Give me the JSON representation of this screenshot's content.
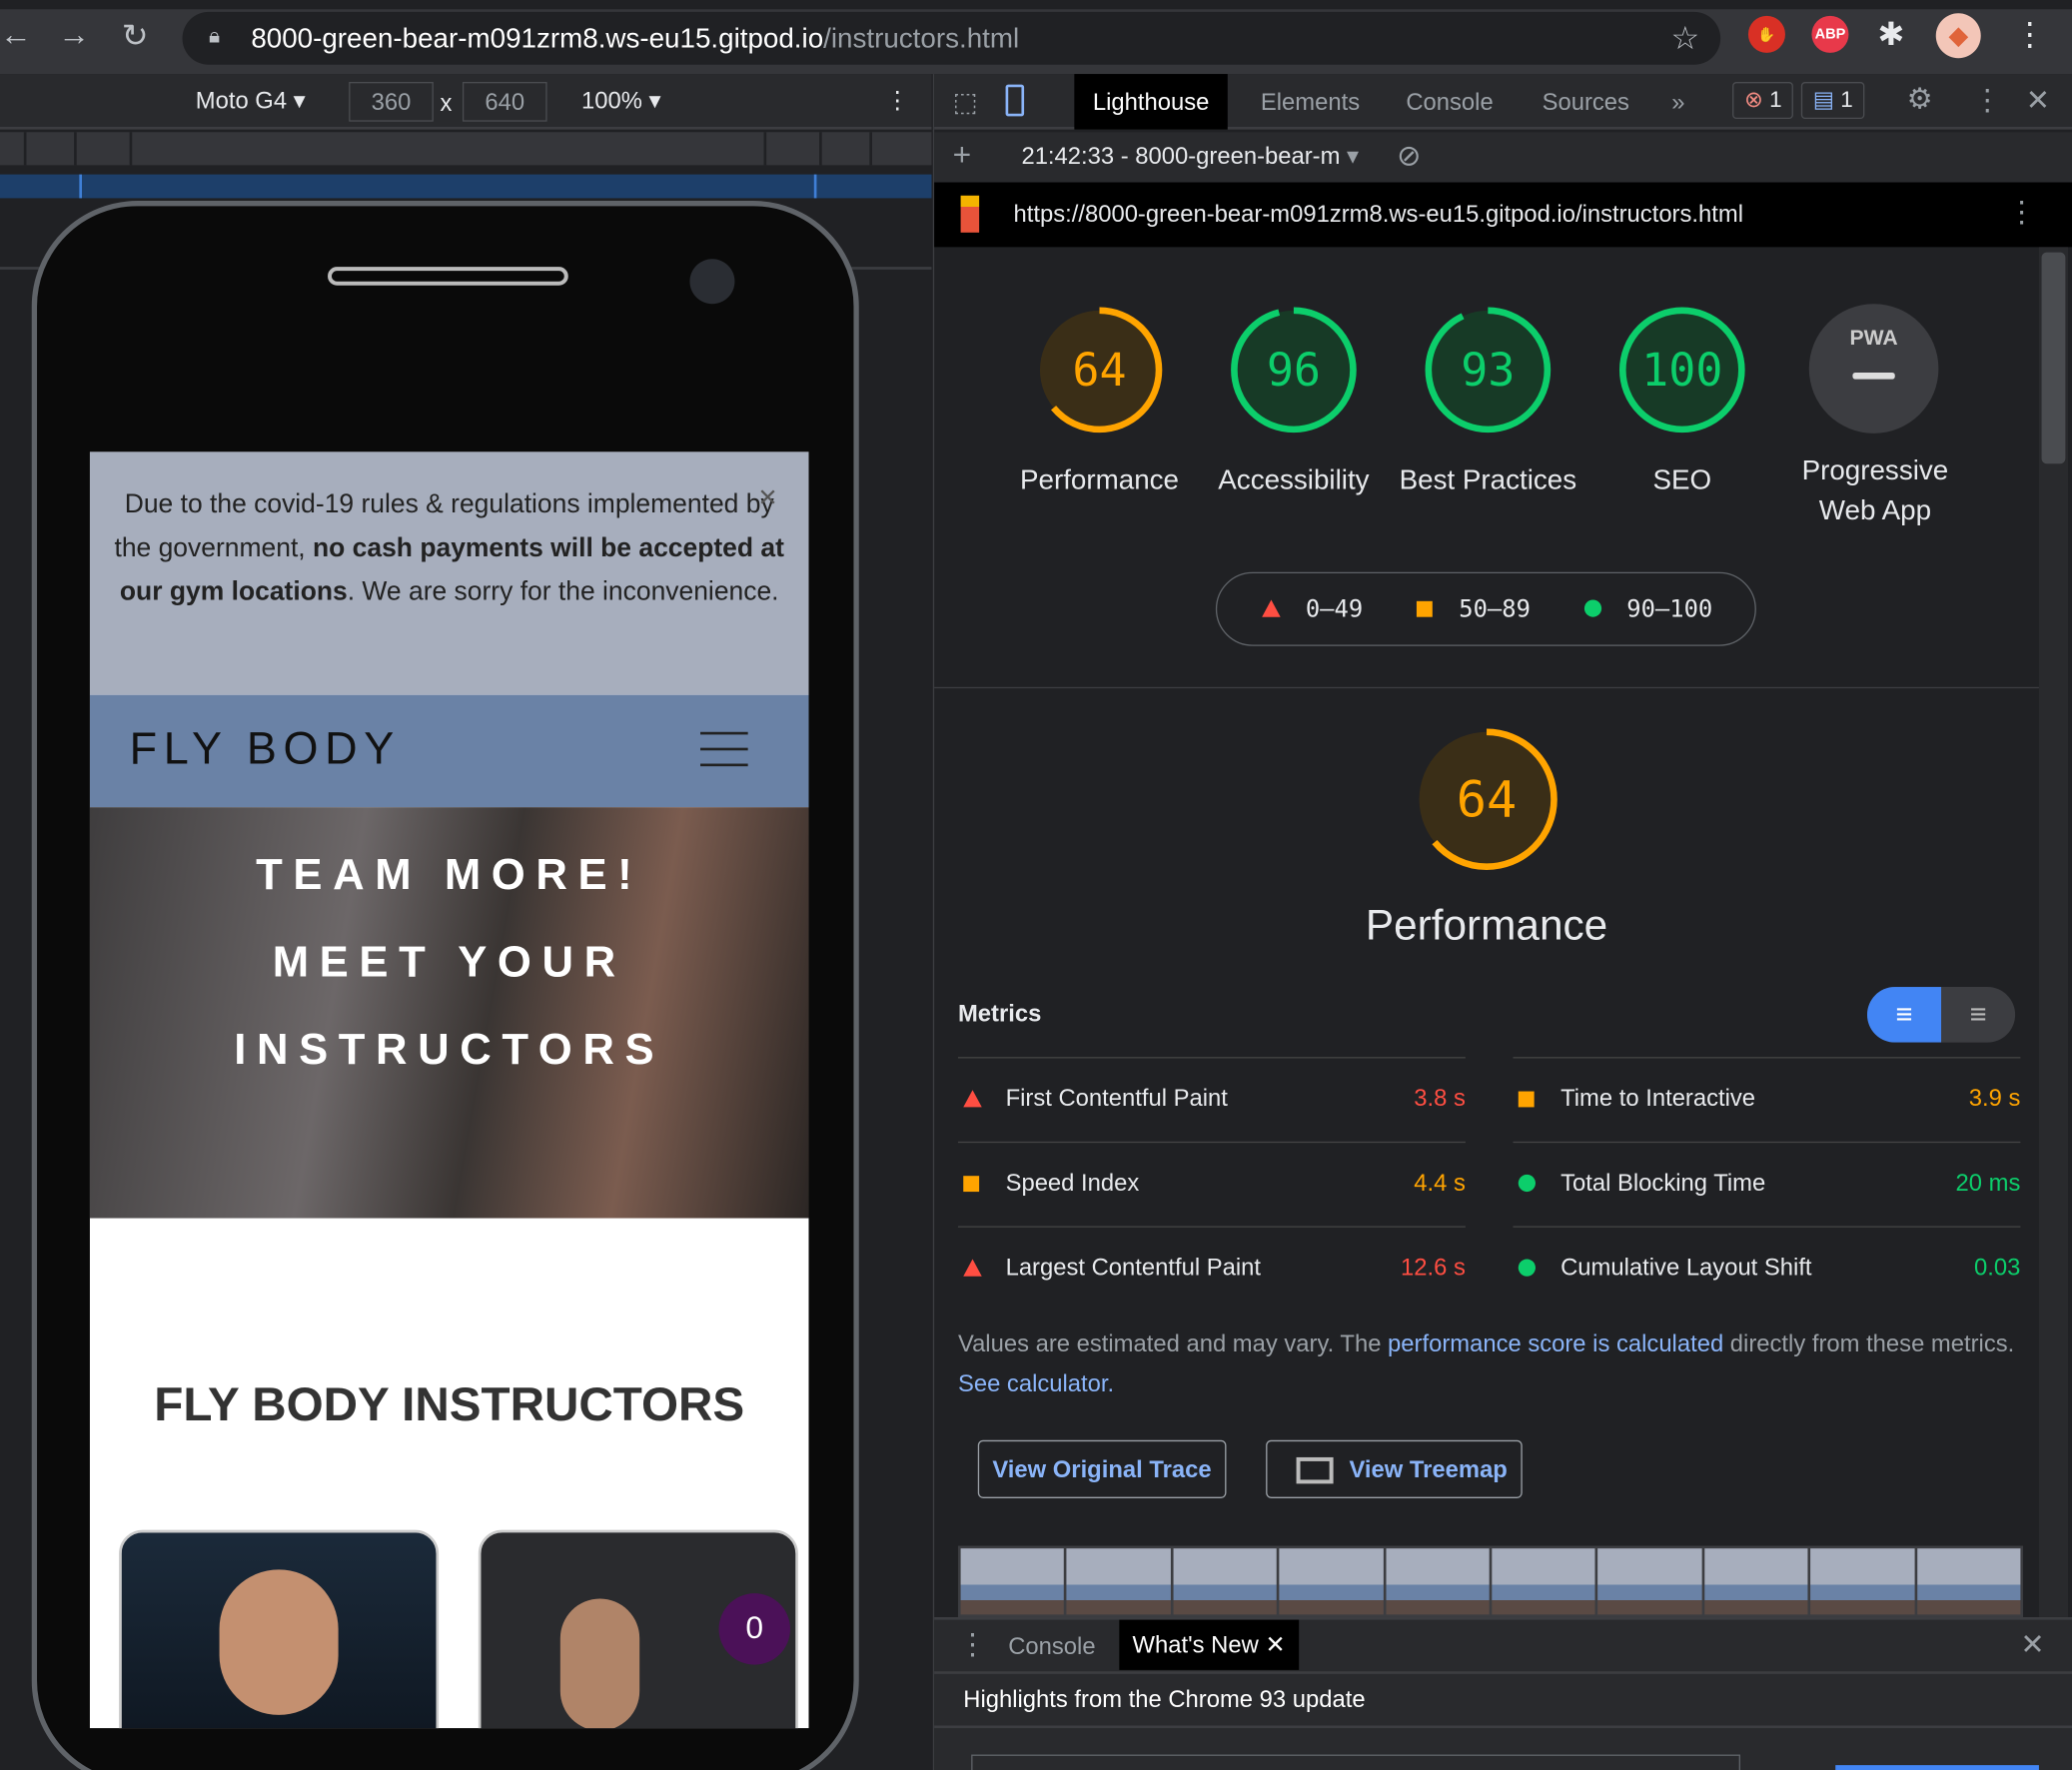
{
  "browser": {
    "url_host": "8000-green-bear-m091zrm8.ws-eu15.gitpod.io",
    "url_path": "/instructors.html",
    "ext_abp": "ABP"
  },
  "device_toolbar": {
    "device": "Moto G4",
    "width": "360",
    "x": "x",
    "height": "640",
    "zoom": "100%"
  },
  "devtools": {
    "tabs": [
      {
        "label": "Lighthouse"
      },
      {
        "label": "Elements"
      },
      {
        "label": "Console"
      },
      {
        "label": "Sources"
      }
    ],
    "more": "»",
    "errors": "1",
    "messages": "1",
    "report_selector": "21:42:33 - 8000-green-bear-m",
    "report_url": "https://8000-green-bear-m091zrm8.ws-eu15.gitpod.io/instructors.html"
  },
  "scores": [
    {
      "value": "64",
      "label": "Performance",
      "color": "#ffa400",
      "pct": 64
    },
    {
      "value": "96",
      "label": "Accessibility",
      "color": "#0cce6b",
      "pct": 96
    },
    {
      "value": "93",
      "label": "Best Practices",
      "color": "#0cce6b",
      "pct": 93
    },
    {
      "value": "100",
      "label": "SEO",
      "color": "#0cce6b",
      "pct": 100
    }
  ],
  "pwa": {
    "label": "Progressive Web App",
    "badge": "PWA"
  },
  "legend": {
    "low": "0–49",
    "mid": "50–89",
    "high": "90–100"
  },
  "performance": {
    "score": "64",
    "title": "Performance",
    "metrics_title": "Metrics",
    "metrics": [
      {
        "name": "First Contentful Paint",
        "value": "3.8 s",
        "rating": "fail"
      },
      {
        "name": "Time to Interactive",
        "value": "3.9 s",
        "rating": "average"
      },
      {
        "name": "Speed Index",
        "value": "4.4 s",
        "rating": "average"
      },
      {
        "name": "Total Blocking Time",
        "value": "20 ms",
        "rating": "pass"
      },
      {
        "name": "Largest Contentful Paint",
        "value": "12.6 s",
        "rating": "fail"
      },
      {
        "name": "Cumulative Layout Shift",
        "value": "0.03",
        "rating": "pass"
      }
    ],
    "note_a": "Values are estimated and may vary. The ",
    "note_link": "performance score is calculated",
    "note_b": " directly from these metrics. ",
    "calc_link": "See calculator.",
    "view_trace": "View Original Trace",
    "view_treemap": "View Treemap"
  },
  "drawer": {
    "tab_console": "Console",
    "tab_whatsnew": "What's New",
    "headline": "Highlights from the Chrome 93 update"
  },
  "site": {
    "banner_a": "Due to the covid-19 rules & regulations implemented by the government, ",
    "banner_bold": "no cash payments will be accepted at our gym locations",
    "banner_b": ". We are sorry for the inconvenience.",
    "close": "×",
    "brand": "FLY BODY",
    "hero": [
      "TEAM MORE!",
      "MEET YOUR",
      "INSTRUCTORS"
    ],
    "section_title": "FLY BODY INSTRUCTORS",
    "cart_count": "0"
  }
}
